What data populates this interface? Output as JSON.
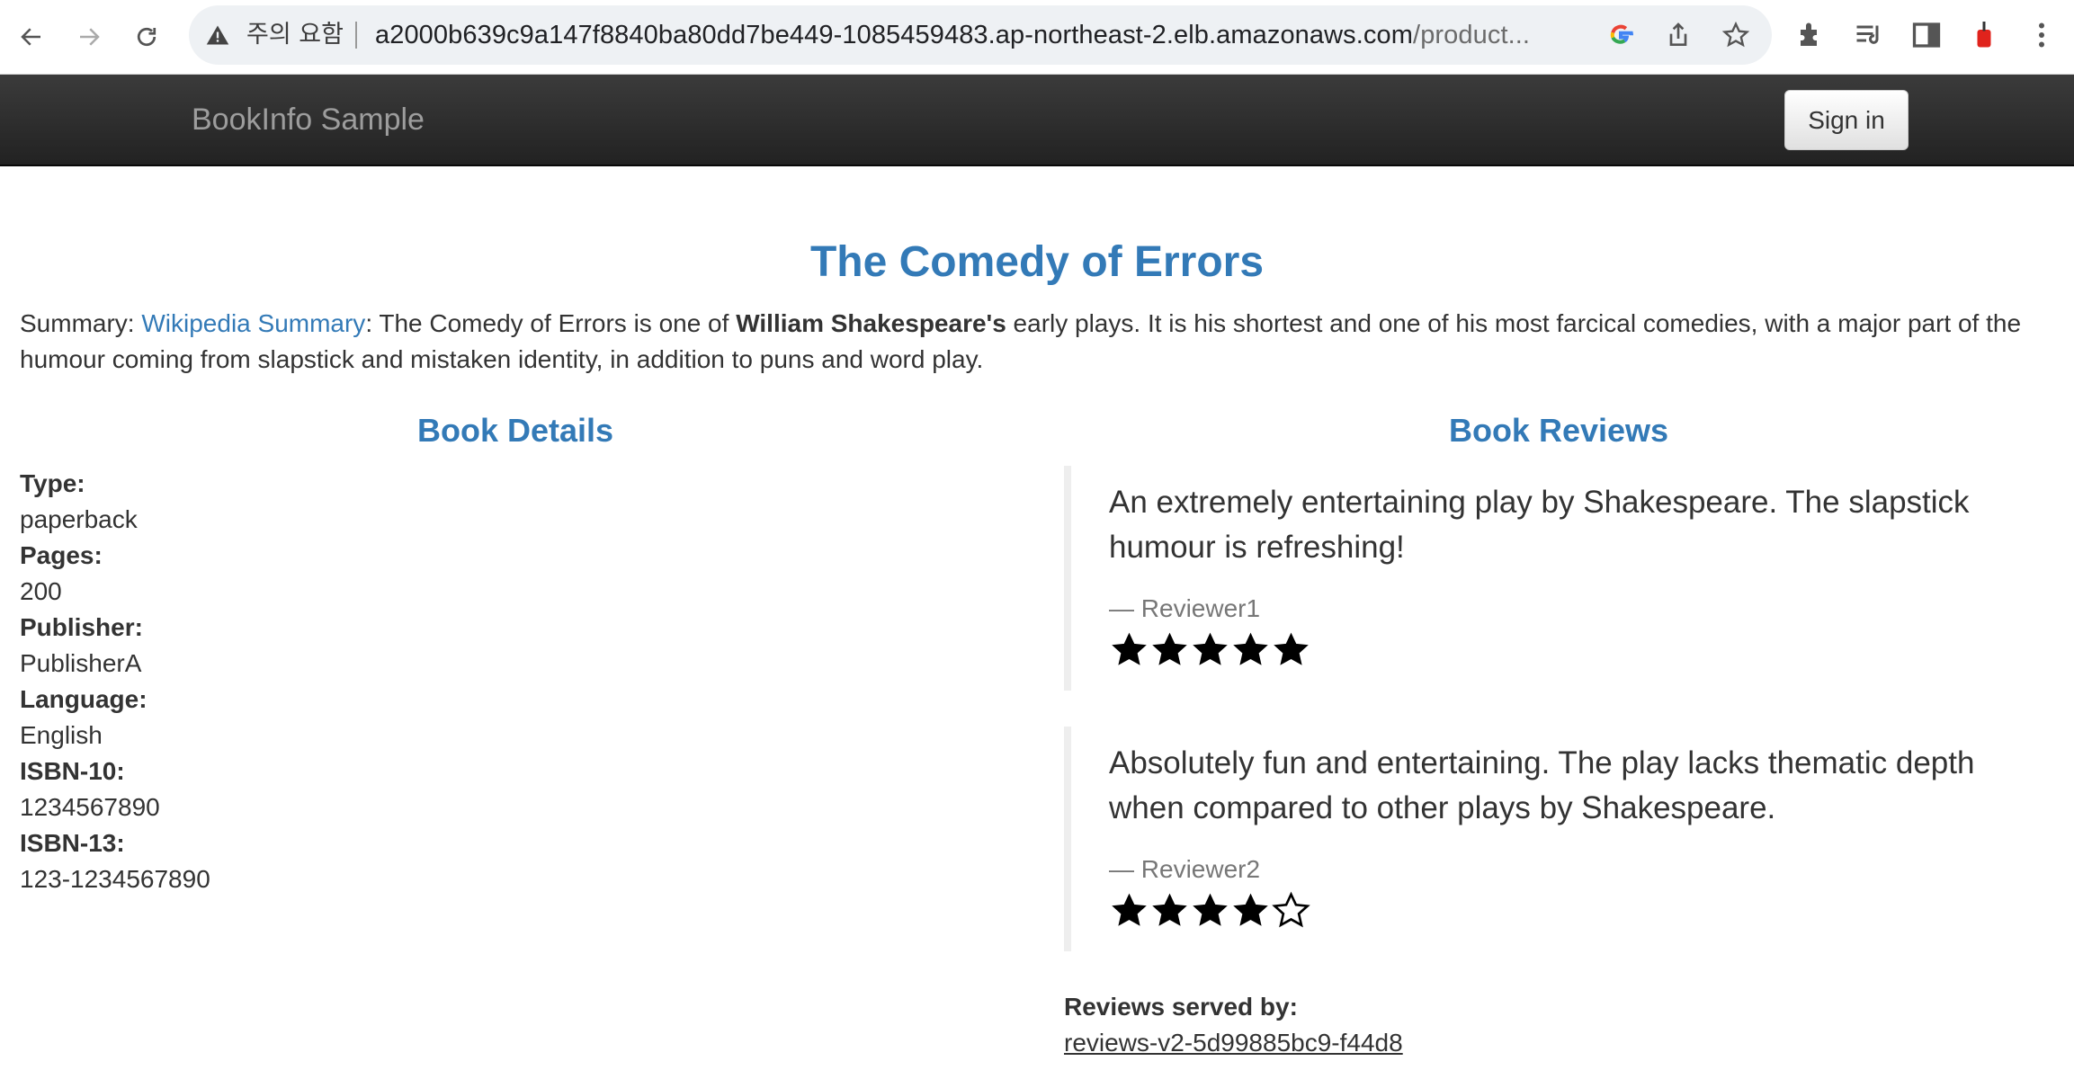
{
  "browser": {
    "security_label": "주의 요함",
    "url_host": "a2000b639c9a147f8840ba80dd7be449-1085459483.ap-northeast-2.elb.amazonaws.com",
    "url_path": "/product...",
    "icons": [
      "back-arrow-icon",
      "forward-arrow-icon",
      "reload-icon",
      "warning-icon",
      "google-icon",
      "share-icon",
      "star-icon",
      "extensions-icon",
      "reading-list-icon",
      "side-panel-icon",
      "extension-red-icon",
      "menu-icon"
    ]
  },
  "navbar": {
    "brand": "BookInfo Sample",
    "signin_label": "Sign in"
  },
  "product": {
    "title": "The Comedy of Errors",
    "summary_label": "Summary:",
    "summary_link": "Wikipedia Summary",
    "summary_pre": ": The Comedy of Errors is one of ",
    "summary_bold": "William Shakespeare's",
    "summary_post": " early plays. It is his shortest and one of his most farcical comedies, with a major part of the humour coming from slapstick and mistaken identity, in addition to puns and word play."
  },
  "details": {
    "heading": "Book Details",
    "fields": [
      {
        "label": "Type:",
        "value": "paperback"
      },
      {
        "label": "Pages:",
        "value": "200"
      },
      {
        "label": "Publisher:",
        "value": "PublisherA"
      },
      {
        "label": "Language:",
        "value": "English"
      },
      {
        "label": "ISBN-10:",
        "value": "1234567890"
      },
      {
        "label": "ISBN-13:",
        "value": "123-1234567890"
      }
    ]
  },
  "reviews": {
    "heading": "Book Reviews",
    "items": [
      {
        "text": "An extremely entertaining play by Shakespeare. The slapstick humour is refreshing!",
        "author": "— Reviewer1",
        "rating": 5,
        "max": 5
      },
      {
        "text": "Absolutely fun and entertaining. The play lacks thematic depth when compared to other plays by Shakespeare.",
        "author": "— Reviewer2",
        "rating": 4,
        "max": 5
      }
    ],
    "served_by_label": "Reviews served by:",
    "served_by_host": "reviews-v2-5d99885bc9-f44d8"
  }
}
